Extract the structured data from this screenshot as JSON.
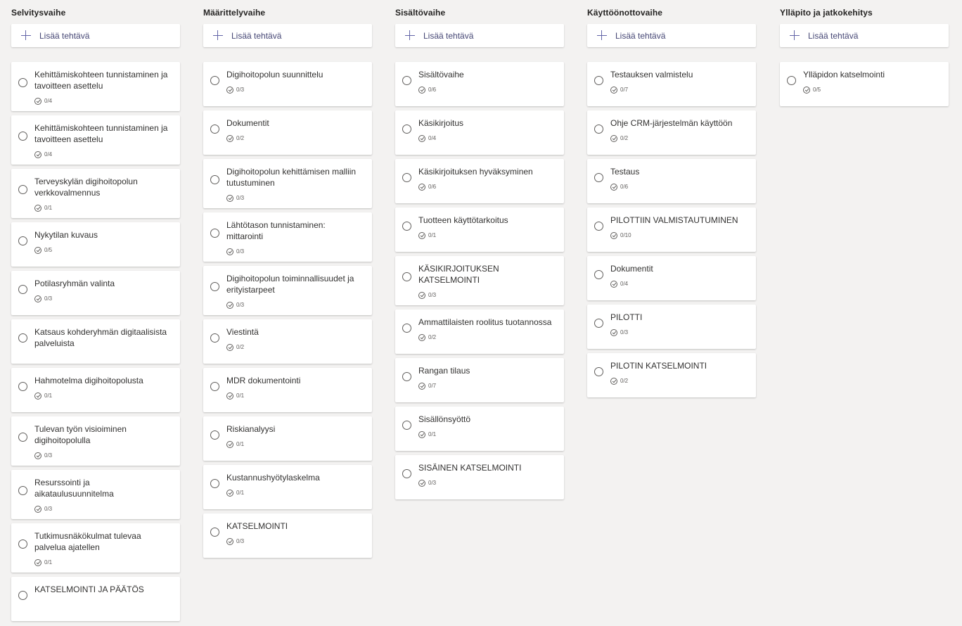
{
  "add_label": "Lisää tehtävä",
  "accent_color": "#6264a7",
  "buckets": [
    {
      "title": "Selvitysvaihe",
      "tasks": [
        {
          "title": "Kehittämiskohteen tunnistaminen ja tavoitteen asettelu",
          "checklist": "0/4"
        },
        {
          "title": "Kehittämiskohteen tunnistaminen ja tavoitteen asettelu",
          "checklist": "0/4"
        },
        {
          "title": "Terveyskylän digihoitopolun verkkovalmennus",
          "checklist": "0/1"
        },
        {
          "title": "Nykytilan kuvaus",
          "checklist": "0/5"
        },
        {
          "title": "Potilasryhmän valinta",
          "checklist": "0/3"
        },
        {
          "title": "Katsaus kohderyhmän digitaalisista palveluista",
          "checklist": ""
        },
        {
          "title": "Hahmotelma digihoitopolusta",
          "checklist": "0/1"
        },
        {
          "title": "Tulevan työn visioiminen digihoitopolulla",
          "checklist": "0/3"
        },
        {
          "title": "Resurssointi ja aikataulusuunnitelma",
          "checklist": "0/3"
        },
        {
          "title": "Tutkimusnäkökulmat tulevaa palvelua ajatellen",
          "checklist": "0/1"
        },
        {
          "title": "KATSELMOINTI JA PÄÄTÖS",
          "checklist": ""
        }
      ]
    },
    {
      "title": "Määrittelyvaihe",
      "tasks": [
        {
          "title": "Digihoitopolun suunnittelu",
          "checklist": "0/3"
        },
        {
          "title": "Dokumentit",
          "checklist": "0/2"
        },
        {
          "title": "Digihoitopolun kehittämisen malliin tutustuminen",
          "checklist": "0/3"
        },
        {
          "title": "Lähtötason tunnistaminen: mittarointi",
          "checklist": "0/3"
        },
        {
          "title": "Digihoitopolun toiminnallisuudet ja erityistarpeet",
          "checklist": "0/3"
        },
        {
          "title": "Viestintä",
          "checklist": "0/2"
        },
        {
          "title": "MDR dokumentointi",
          "checklist": "0/1"
        },
        {
          "title": "Riskianalyysi",
          "checklist": "0/1"
        },
        {
          "title": "Kustannushyötylaskelma",
          "checklist": "0/1"
        },
        {
          "title": "KATSELMOINTI",
          "checklist": "0/3"
        }
      ]
    },
    {
      "title": "Sisältövaihe",
      "tasks": [
        {
          "title": "Sisältövaihe",
          "checklist": "0/6"
        },
        {
          "title": "Käsikirjoitus",
          "checklist": "0/4"
        },
        {
          "title": "Käsikirjoituksen hyväksyminen",
          "checklist": "0/6"
        },
        {
          "title": "Tuotteen käyttötarkoitus",
          "checklist": "0/1"
        },
        {
          "title": "KÄSIKIRJOITUKSEN KATSELMOINTI",
          "checklist": "0/3"
        },
        {
          "title": "Ammattilaisten roolitus tuotannossa",
          "checklist": "0/2"
        },
        {
          "title": "Rangan tilaus",
          "checklist": "0/7"
        },
        {
          "title": "Sisällönsyöttö",
          "checklist": "0/1"
        },
        {
          "title": "SISÄINEN KATSELMOINTI",
          "checklist": "0/3"
        }
      ]
    },
    {
      "title": "Käyttöönottovaihe",
      "tasks": [
        {
          "title": "Testauksen valmistelu",
          "checklist": "0/7"
        },
        {
          "title": "Ohje CRM-järjestelmän käyttöön",
          "checklist": "0/2"
        },
        {
          "title": "Testaus",
          "checklist": "0/6"
        },
        {
          "title": "PILOTTIIN VALMISTAUTUMINEN",
          "checklist": "0/10"
        },
        {
          "title": "Dokumentit",
          "checklist": "0/4"
        },
        {
          "title": "PILOTTI",
          "checklist": "0/3"
        },
        {
          "title": "PILOTIN KATSELMOINTI",
          "checklist": "0/2"
        }
      ]
    },
    {
      "title": "Ylläpito ja jatkokehitys",
      "tasks": [
        {
          "title": "Ylläpidon katselmointi",
          "checklist": "0/5"
        }
      ]
    }
  ]
}
